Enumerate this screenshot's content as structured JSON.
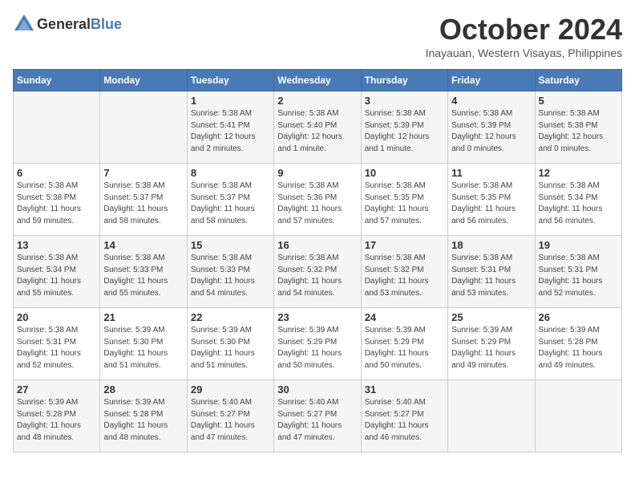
{
  "logo": {
    "general": "General",
    "blue": "Blue"
  },
  "header": {
    "month": "October 2024",
    "location": "Inayauan, Western Visayas, Philippines"
  },
  "columns": [
    "Sunday",
    "Monday",
    "Tuesday",
    "Wednesday",
    "Thursday",
    "Friday",
    "Saturday"
  ],
  "weeks": [
    [
      {
        "day": "",
        "info": ""
      },
      {
        "day": "",
        "info": ""
      },
      {
        "day": "1",
        "info": "Sunrise: 5:38 AM\nSunset: 5:41 PM\nDaylight: 12 hours\nand 2 minutes."
      },
      {
        "day": "2",
        "info": "Sunrise: 5:38 AM\nSunset: 5:40 PM\nDaylight: 12 hours\nand 1 minute."
      },
      {
        "day": "3",
        "info": "Sunrise: 5:38 AM\nSunset: 5:39 PM\nDaylight: 12 hours\nand 1 minute."
      },
      {
        "day": "4",
        "info": "Sunrise: 5:38 AM\nSunset: 5:39 PM\nDaylight: 12 hours\nand 0 minutes."
      },
      {
        "day": "5",
        "info": "Sunrise: 5:38 AM\nSunset: 5:38 PM\nDaylight: 12 hours\nand 0 minutes."
      }
    ],
    [
      {
        "day": "6",
        "info": "Sunrise: 5:38 AM\nSunset: 5:38 PM\nDaylight: 11 hours\nand 59 minutes."
      },
      {
        "day": "7",
        "info": "Sunrise: 5:38 AM\nSunset: 5:37 PM\nDaylight: 11 hours\nand 58 minutes."
      },
      {
        "day": "8",
        "info": "Sunrise: 5:38 AM\nSunset: 5:37 PM\nDaylight: 11 hours\nand 58 minutes."
      },
      {
        "day": "9",
        "info": "Sunrise: 5:38 AM\nSunset: 5:36 PM\nDaylight: 11 hours\nand 57 minutes."
      },
      {
        "day": "10",
        "info": "Sunrise: 5:38 AM\nSunset: 5:35 PM\nDaylight: 11 hours\nand 57 minutes."
      },
      {
        "day": "11",
        "info": "Sunrise: 5:38 AM\nSunset: 5:35 PM\nDaylight: 11 hours\nand 56 minutes."
      },
      {
        "day": "12",
        "info": "Sunrise: 5:38 AM\nSunset: 5:34 PM\nDaylight: 11 hours\nand 56 minutes."
      }
    ],
    [
      {
        "day": "13",
        "info": "Sunrise: 5:38 AM\nSunset: 5:34 PM\nDaylight: 11 hours\nand 55 minutes."
      },
      {
        "day": "14",
        "info": "Sunrise: 5:38 AM\nSunset: 5:33 PM\nDaylight: 11 hours\nand 55 minutes."
      },
      {
        "day": "15",
        "info": "Sunrise: 5:38 AM\nSunset: 5:33 PM\nDaylight: 11 hours\nand 54 minutes."
      },
      {
        "day": "16",
        "info": "Sunrise: 5:38 AM\nSunset: 5:32 PM\nDaylight: 11 hours\nand 54 minutes."
      },
      {
        "day": "17",
        "info": "Sunrise: 5:38 AM\nSunset: 5:32 PM\nDaylight: 11 hours\nand 53 minutes."
      },
      {
        "day": "18",
        "info": "Sunrise: 5:38 AM\nSunset: 5:31 PM\nDaylight: 11 hours\nand 53 minutes."
      },
      {
        "day": "19",
        "info": "Sunrise: 5:38 AM\nSunset: 5:31 PM\nDaylight: 11 hours\nand 52 minutes."
      }
    ],
    [
      {
        "day": "20",
        "info": "Sunrise: 5:38 AM\nSunset: 5:31 PM\nDaylight: 11 hours\nand 52 minutes."
      },
      {
        "day": "21",
        "info": "Sunrise: 5:39 AM\nSunset: 5:30 PM\nDaylight: 11 hours\nand 51 minutes."
      },
      {
        "day": "22",
        "info": "Sunrise: 5:39 AM\nSunset: 5:30 PM\nDaylight: 11 hours\nand 51 minutes."
      },
      {
        "day": "23",
        "info": "Sunrise: 5:39 AM\nSunset: 5:29 PM\nDaylight: 11 hours\nand 50 minutes."
      },
      {
        "day": "24",
        "info": "Sunrise: 5:39 AM\nSunset: 5:29 PM\nDaylight: 11 hours\nand 50 minutes."
      },
      {
        "day": "25",
        "info": "Sunrise: 5:39 AM\nSunset: 5:29 PM\nDaylight: 11 hours\nand 49 minutes."
      },
      {
        "day": "26",
        "info": "Sunrise: 5:39 AM\nSunset: 5:28 PM\nDaylight: 11 hours\nand 49 minutes."
      }
    ],
    [
      {
        "day": "27",
        "info": "Sunrise: 5:39 AM\nSunset: 5:28 PM\nDaylight: 11 hours\nand 48 minutes."
      },
      {
        "day": "28",
        "info": "Sunrise: 5:39 AM\nSunset: 5:28 PM\nDaylight: 11 hours\nand 48 minutes."
      },
      {
        "day": "29",
        "info": "Sunrise: 5:40 AM\nSunset: 5:27 PM\nDaylight: 11 hours\nand 47 minutes."
      },
      {
        "day": "30",
        "info": "Sunrise: 5:40 AM\nSunset: 5:27 PM\nDaylight: 11 hours\nand 47 minutes."
      },
      {
        "day": "31",
        "info": "Sunrise: 5:40 AM\nSunset: 5:27 PM\nDaylight: 11 hours\nand 46 minutes."
      },
      {
        "day": "",
        "info": ""
      },
      {
        "day": "",
        "info": ""
      }
    ]
  ]
}
